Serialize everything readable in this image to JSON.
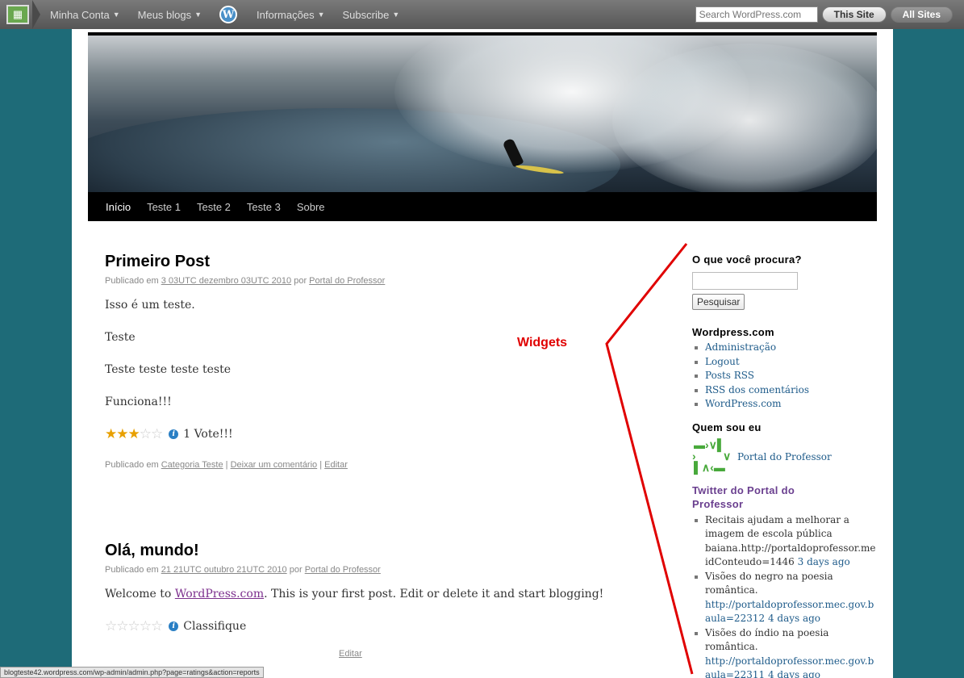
{
  "adminbar": {
    "menus": [
      "Minha Conta",
      "Meus blogs",
      "Informações",
      "Subscribe"
    ],
    "wp_logo": "W",
    "search_placeholder": "Search WordPress.com",
    "this_site": "This Site",
    "all_sites": "All Sites"
  },
  "nav": [
    "Início",
    "Teste 1",
    "Teste 2",
    "Teste 3",
    "Sobre"
  ],
  "posts": [
    {
      "title": "Primeiro Post",
      "meta_prefix": "Publicado em",
      "date": "3 03UTC dezembro 03UTC 2010",
      "by": "por",
      "author": "Portal do Professor",
      "paragraphs": [
        "Isso é um teste.",
        "Teste",
        "Teste teste teste teste",
        "Funciona!!!"
      ],
      "rating_stars": 3,
      "rating_text": "1 Vote!!!",
      "footer_prefix": "Publicado em",
      "category": "Categoria Teste",
      "comment": "Deixar um comentário",
      "edit": "Editar"
    },
    {
      "title": "Olá, mundo!",
      "meta_prefix": "Publicado em",
      "date": "21 21UTC outubro 21UTC 2010",
      "by": "por",
      "author": "Portal do Professor",
      "welcome_prefix": "Welcome to",
      "welcome_link": "WordPress.com",
      "welcome_suffix": ". This is your first post. Edit or delete it and start blogging!",
      "rating_stars": 0,
      "rating_text": "Classifique",
      "edit": "Editar"
    }
  ],
  "sidebar": {
    "search_title": "O que você procura?",
    "search_button": "Pesquisar",
    "wp_title": "Wordpress.com",
    "wp_links": [
      "Administração",
      "Logout",
      "Posts RSS",
      "RSS dos comentários",
      "WordPress.com"
    ],
    "who_title": "Quem sou eu",
    "who_name": "Portal do Professor",
    "twitter_title": "Twitter do Portal do Professor",
    "tweets": [
      {
        "text": "Recitais ajudam a melhorar a imagem de escola pública baiana.http://portaldoprofessor.me idConteudo=1446",
        "time": "3 days ago"
      },
      {
        "text": "Visões do negro na poesia romântica.",
        "link": "http://portaldoprofessor.mec.gov.b aula=22312",
        "time": "4 days ago"
      },
      {
        "text": "Visões do índio na poesia romântica.",
        "link": "http://portaldoprofessor.mec.gov.b aula=22311",
        "time": "4 days ago"
      }
    ]
  },
  "annotation": "Widgets",
  "status_url": "blogteste42.wordpress.com/wp-admin/admin.php?page=ratings&action=reports",
  "colors": {
    "accent_red": "#e00000",
    "twitter_title": "#6a3f8f",
    "link": "#1e5b8a",
    "star": "#e8a000"
  }
}
